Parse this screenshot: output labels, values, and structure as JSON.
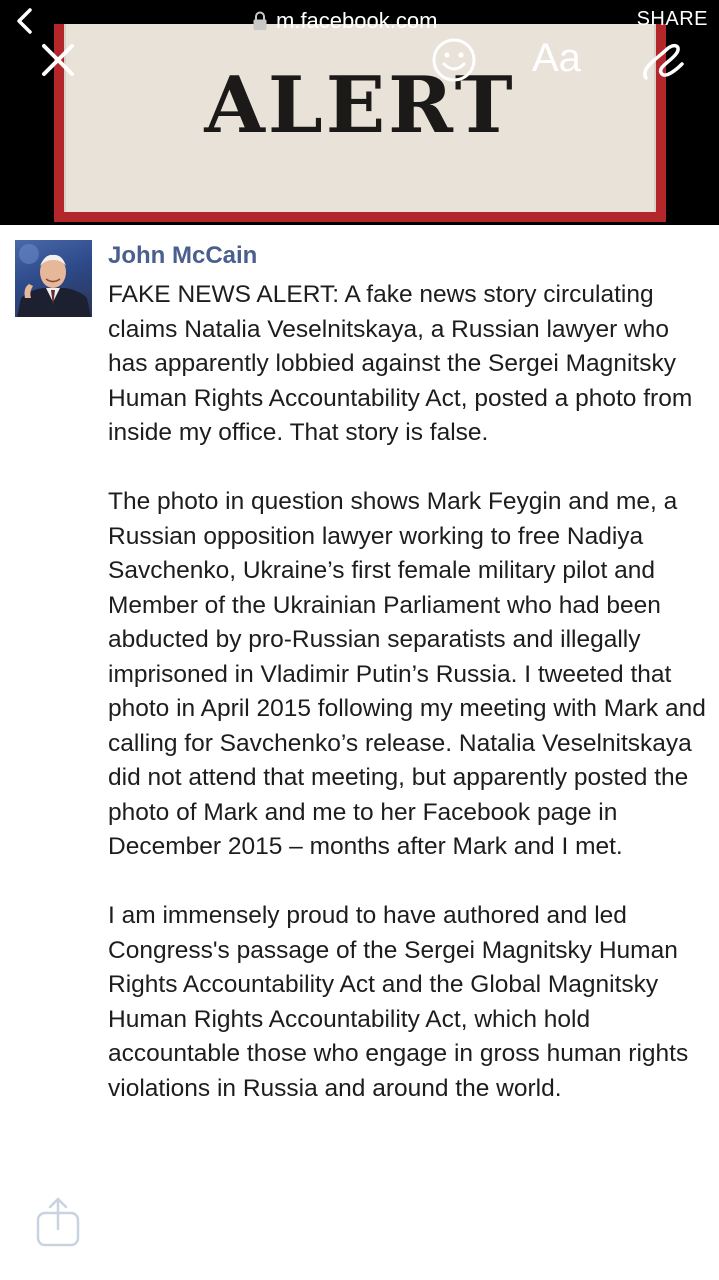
{
  "browser": {
    "url": "m.facebook.com",
    "share_label": "SHARE",
    "back_icon": "chevron-left-icon",
    "lock_icon": "lock-icon"
  },
  "story_tools": {
    "close_icon": "close-icon",
    "sticker_icon": "smiley-icon",
    "text_tool_label": "Aa",
    "draw_icon": "draw-icon"
  },
  "image_banner": {
    "headline": "ALERT",
    "card_color": "#b3262a",
    "paper_color": "#e9e2d8"
  },
  "post": {
    "author": "John McCain",
    "paragraphs": [
      "FAKE NEWS ALERT: A fake news story circulating claims Natalia Veselnitskaya, a Russian lawyer who has apparently lobbied against the Sergei Magnitsky Human Rights Accountability Act, posted a photo from inside my office. That story is false.",
      "The photo in question shows Mark Feygin and me, a Russian opposition lawyer working to free Nadiya Savchenko, Ukraine’s first female military pilot and Member of the Ukrainian Parliament who had been abducted by pro-Russian separatists and illegally imprisoned in Vladimir Putin’s Russia. I tweeted that photo in April 2015 following my meeting with Mark and calling for Savchenko’s release. Natalia Veselnitskaya did not attend that meeting, but apparently posted the photo of Mark and me to her Facebook page in December 2015 – months after Mark and I met.",
      "I am immensely proud to have authored and led Congress's passage of the Sergei Magnitsky Human Rights Accountability Act and the Global Magnitsky Human Rights Accountability Act, which hold accountable those who engage in gross human rights violations in Russia and around the world."
    ],
    "author_color": "#4b5f8e"
  },
  "footer": {
    "share_icon": "share-icon"
  }
}
